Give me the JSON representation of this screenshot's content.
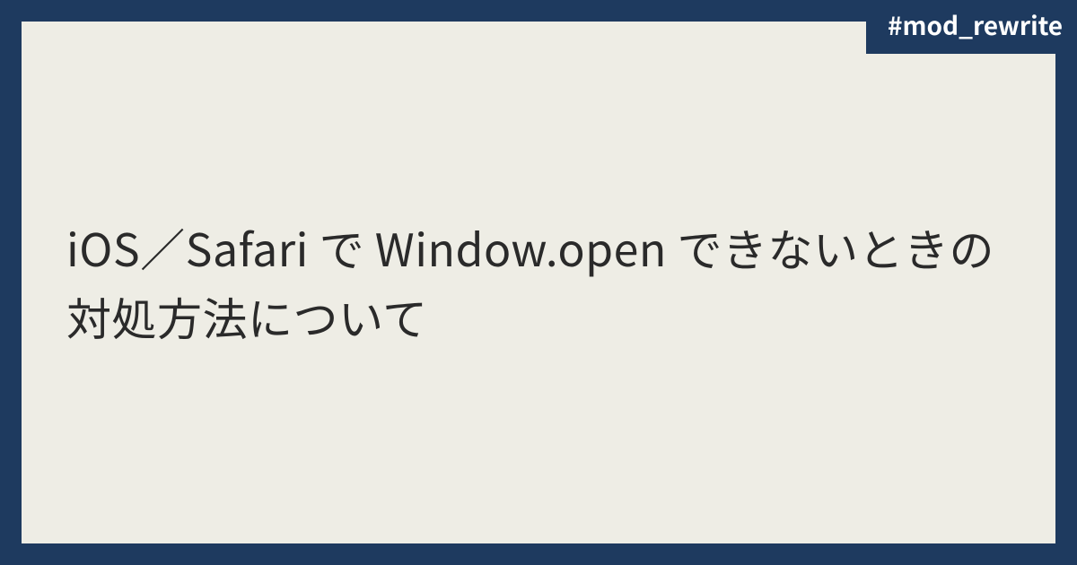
{
  "tag": "#mod_rewrite",
  "title": " iOS／Safari で Window.open できないときの対処方法について"
}
